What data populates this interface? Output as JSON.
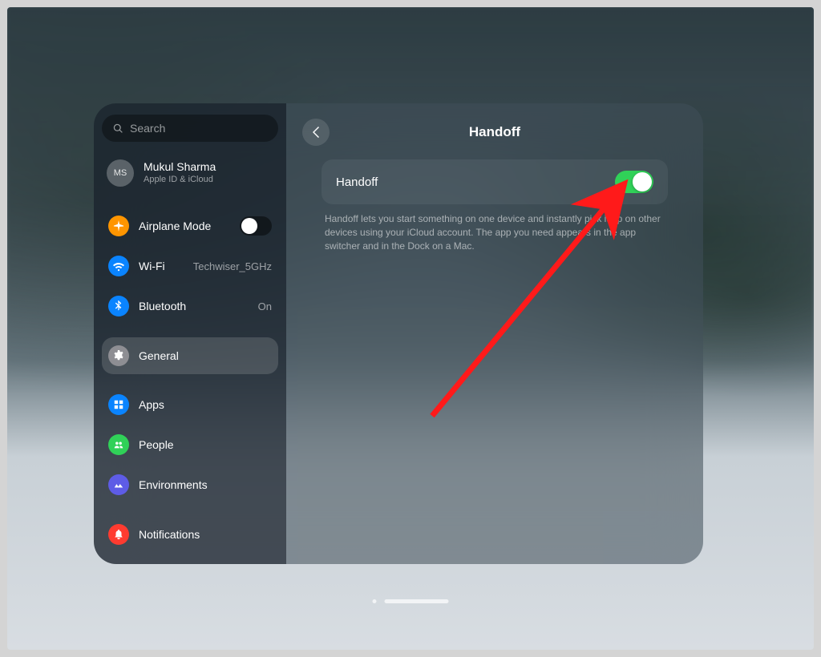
{
  "search": {
    "placeholder": "Search"
  },
  "account": {
    "initials": "MS",
    "name": "Mukul Sharma",
    "sub": "Apple ID & iCloud"
  },
  "sidebar": {
    "items": [
      {
        "label": "Airplane Mode",
        "value": ""
      },
      {
        "label": "Wi-Fi",
        "value": "Techwiser_5GHz"
      },
      {
        "label": "Bluetooth",
        "value": "On"
      },
      {
        "label": "General",
        "value": ""
      },
      {
        "label": "Apps",
        "value": ""
      },
      {
        "label": "People",
        "value": ""
      },
      {
        "label": "Environments",
        "value": ""
      },
      {
        "label": "Notifications",
        "value": ""
      }
    ]
  },
  "main": {
    "title": "Handoff",
    "toggle_label": "Handoff",
    "toggle_state": "on",
    "description": "Handoff lets you start something on one device and instantly pick it up on other devices using your iCloud account. The app you need appears in the app switcher and in the Dock on a Mac."
  },
  "colors": {
    "accent_toggle_on": "#30d158",
    "arrow": "#ff1a1a"
  }
}
